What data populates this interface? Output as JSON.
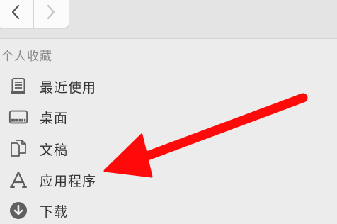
{
  "toolbar": {
    "back_icon": "chevron-left-icon",
    "forward_icon": "chevron-right-icon"
  },
  "sidebar": {
    "section_title": "个人收藏",
    "items": [
      {
        "label": "最近使用",
        "icon": "recents-icon"
      },
      {
        "label": "桌面",
        "icon": "desktop-icon"
      },
      {
        "label": "文稿",
        "icon": "documents-icon"
      },
      {
        "label": "应用程序",
        "icon": "applications-icon"
      },
      {
        "label": "下载",
        "icon": "downloads-icon"
      }
    ]
  },
  "annotation": {
    "arrow_color": "#ff0a0a",
    "points_to": "应用程序"
  }
}
